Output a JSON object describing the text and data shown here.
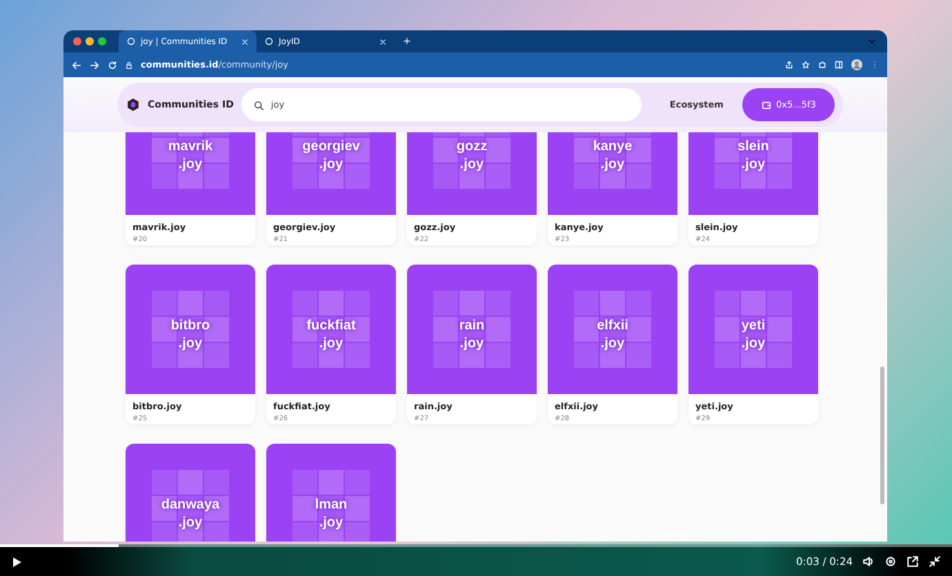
{
  "browser": {
    "tabs": [
      {
        "title": "joy | Communities ID",
        "selected": true
      },
      {
        "title": "JoyID",
        "selected": false
      }
    ],
    "new_tab": "+",
    "url": "**communities.id**/community/joy"
  },
  "site_nav": {
    "logo": "Communities ID",
    "search": {
      "value": "joy"
    },
    "links": [
      "Ecosystem"
    ],
    "wallet_button": "0x5...5f3"
  },
  "cards": [
    {
      "tile_name": "mavrik",
      "tile_suffix": ".joy",
      "name": "mavrik.joy",
      "number": "#20"
    },
    {
      "tile_name": "georgiev",
      "tile_suffix": ".joy",
      "name": "georgiev.joy",
      "number": "#21"
    },
    {
      "tile_name": "gozz",
      "tile_suffix": ".joy",
      "name": "gozz.joy",
      "number": "#22"
    },
    {
      "tile_name": "kanye",
      "tile_suffix": ".joy",
      "name": "kanye.joy",
      "number": "#23"
    },
    {
      "tile_name": "slein",
      "tile_suffix": ".joy",
      "name": "slein.joy",
      "number": "#24"
    },
    {
      "tile_name": "bitbro",
      "tile_suffix": ".joy",
      "name": "bitbro.joy",
      "number": "#25"
    },
    {
      "tile_name": "fuckfiat",
      "tile_suffix": ".joy",
      "name": "fuckfiat.joy",
      "number": "#26"
    },
    {
      "tile_name": "rain",
      "tile_suffix": ".joy",
      "name": "rain.joy",
      "number": "#27"
    },
    {
      "tile_name": "elfxii",
      "tile_suffix": ".joy",
      "name": "elfxii.joy",
      "number": "#28"
    },
    {
      "tile_name": "yeti",
      "tile_suffix": ".joy",
      "name": "yeti.joy",
      "number": "#29"
    },
    {
      "tile_name": "danwaya",
      "tile_suffix": ".joy"
    },
    {
      "tile_name": "lman",
      "tile_suffix": ".joy"
    }
  ],
  "player": {
    "level": 0.125,
    "time": "0:03 / 0:24"
  }
}
